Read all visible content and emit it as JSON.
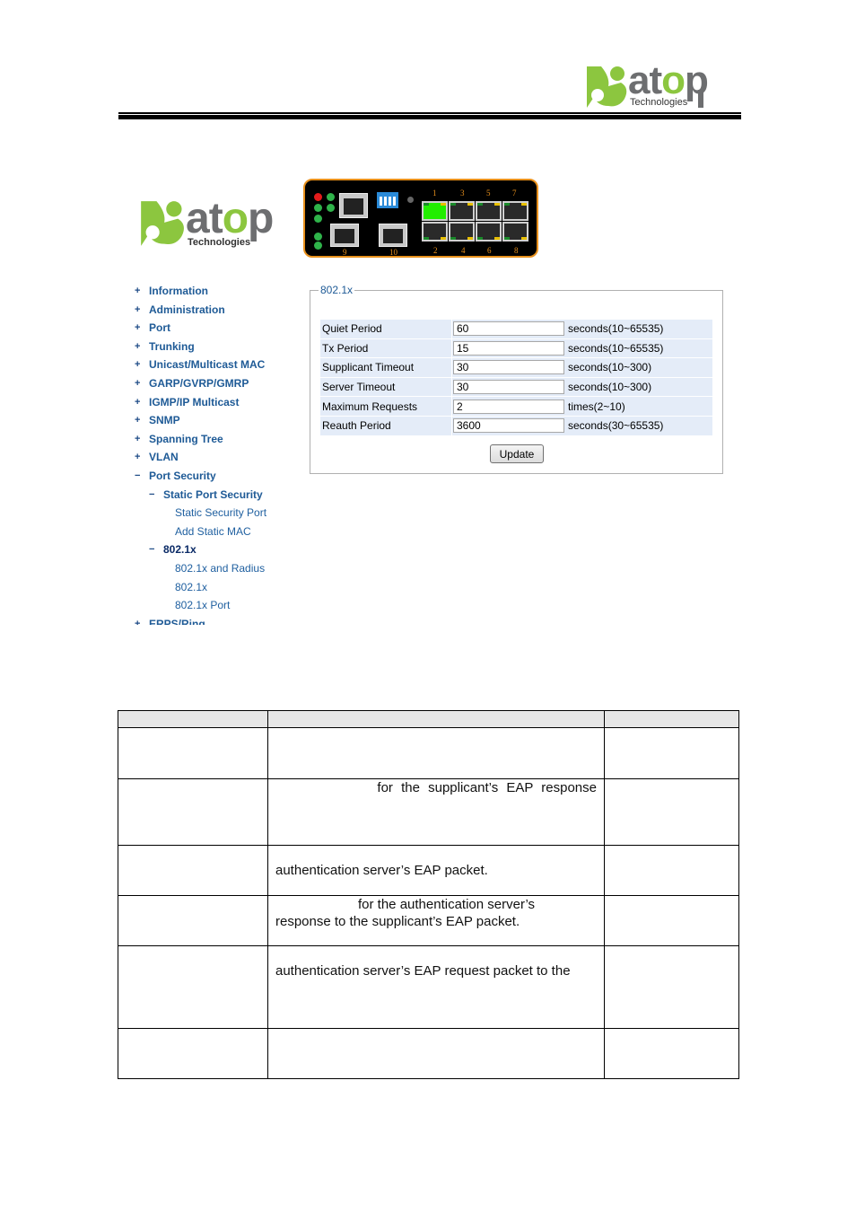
{
  "page_header": {
    "logo": {
      "brand": "atop",
      "brand_o_letter": "o",
      "tagline": "Technologies",
      "mark_color": "#8cc63f",
      "text_color": "#6d6e70"
    }
  },
  "web_ui": {
    "logo": {
      "brand": "atop",
      "tagline": "Technologies"
    },
    "device_panel": {
      "top_port_labels": [
        "1",
        "3",
        "5",
        "7"
      ],
      "bottom_port_labels": [
        "2",
        "4",
        "6",
        "8"
      ],
      "uplink_port_labels": [
        "9",
        "10"
      ],
      "active_port": "1",
      "accent_color": "#e8901c",
      "active_color": "#22ee00"
    },
    "menu": [
      {
        "symbol": "+",
        "label": "Information",
        "level": 1
      },
      {
        "symbol": "+",
        "label": "Administration",
        "level": 1
      },
      {
        "symbol": "+",
        "label": "Port",
        "level": 1
      },
      {
        "symbol": "+",
        "label": "Trunking",
        "level": 1
      },
      {
        "symbol": "+",
        "label": "Unicast/Multicast MAC",
        "level": 1
      },
      {
        "symbol": "+",
        "label": "GARP/GVRP/GMRP",
        "level": 1
      },
      {
        "symbol": "+",
        "label": "IGMP/IP Multicast",
        "level": 1
      },
      {
        "symbol": "+",
        "label": "SNMP",
        "level": 1
      },
      {
        "symbol": "+",
        "label": "Spanning Tree",
        "level": 1
      },
      {
        "symbol": "+",
        "label": "VLAN",
        "level": 1
      },
      {
        "symbol": "−",
        "label": "Port Security",
        "level": 1
      },
      {
        "symbol": "−",
        "label": "Static Port Security",
        "level": 2
      },
      {
        "symbol": "",
        "label": "Static Security Port",
        "level": 3
      },
      {
        "symbol": "",
        "label": "Add Static MAC",
        "level": 3
      },
      {
        "symbol": "−",
        "label": "802.1x",
        "level": 2
      },
      {
        "symbol": "",
        "label": "802.1x and Radius",
        "level": 3
      },
      {
        "symbol": "",
        "label": "802.1x",
        "level": 3
      },
      {
        "symbol": "",
        "label": "802.1x Port",
        "level": 3
      },
      {
        "symbol": "+",
        "label": "ERPS/Ring",
        "level": 1
      }
    ],
    "form": {
      "legend": "802.1x",
      "rows": [
        {
          "label": "Quiet Period",
          "value": "60",
          "unit": "seconds(10~65535)"
        },
        {
          "label": "Tx Period",
          "value": "15",
          "unit": "seconds(10~65535)"
        },
        {
          "label": "Supplicant Timeout",
          "value": "30",
          "unit": "seconds(10~300)"
        },
        {
          "label": "Server Timeout",
          "value": "30",
          "unit": "seconds(10~300)"
        },
        {
          "label": "Maximum Requests",
          "value": "2",
          "unit": "times(2~10)"
        },
        {
          "label": "Reauth Period",
          "value": "3600",
          "unit": "seconds(30~65535)"
        }
      ],
      "update_label": "Update"
    }
  },
  "doc_table": {
    "headers": [
      "",
      "",
      ""
    ],
    "rows": [
      {
        "c1": "",
        "c2": "",
        "c3": ""
      },
      {
        "c1": "",
        "c2": "for the supplicant’s EAP response",
        "c3": ""
      },
      {
        "c1": "",
        "c2": "authentication server’s EAP packet.",
        "c3": ""
      },
      {
        "c1": "",
        "c2a": "for the authentication server’s",
        "c2b": "response to the supplicant’s EAP packet.",
        "c3": ""
      },
      {
        "c1": "",
        "c2": "authentication server’s EAP request packet to the",
        "c3": ""
      },
      {
        "c1": "",
        "c2": "",
        "c3": ""
      }
    ]
  }
}
